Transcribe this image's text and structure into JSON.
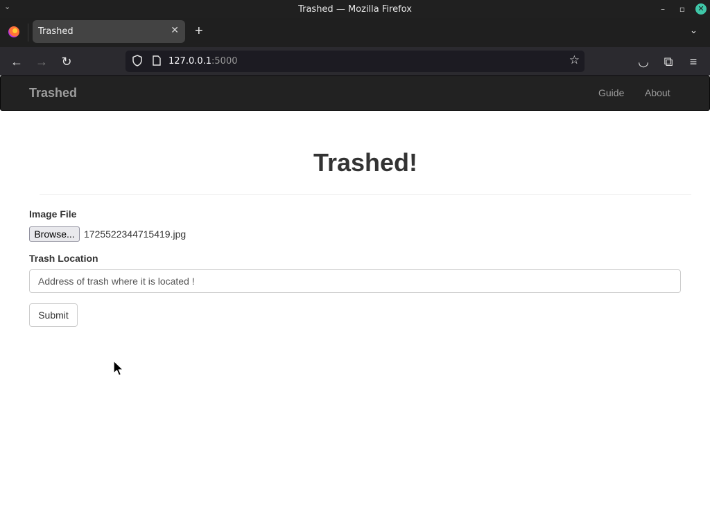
{
  "window": {
    "title": "Trashed — Mozilla Firefox",
    "sys_menu_glyph": "⌄",
    "minimize_glyph": "–",
    "maximize_glyph": "▫",
    "close_glyph": "✕"
  },
  "browser": {
    "tab_title": "Trashed",
    "tab_close_glyph": "✕",
    "new_tab_glyph": "+",
    "tab_list_glyph": "⌄",
    "url_host": "127.0.0.1",
    "url_port": ":5000",
    "back_glyph": "←",
    "forward_glyph": "→",
    "reload_glyph": "↻",
    "bookmark_glyph": "☆",
    "pocket_glyph": "◡",
    "extensions_glyph": "⧉",
    "menu_glyph": "≡"
  },
  "site_nav": {
    "brand": "Trashed",
    "links": [
      "Guide",
      "About"
    ]
  },
  "main": {
    "heading": "Trashed!",
    "form": {
      "image_label": "Image File",
      "browse_label": "Browse...",
      "file_name": "1725522344715419.jpg",
      "location_label": "Trash Location",
      "location_placeholder": "Address of trash where it is located !",
      "submit_label": "Submit"
    }
  },
  "colors": {
    "nav_bg": "#222222",
    "nav_text": "#9d9d9d",
    "heading_text": "#333333"
  }
}
